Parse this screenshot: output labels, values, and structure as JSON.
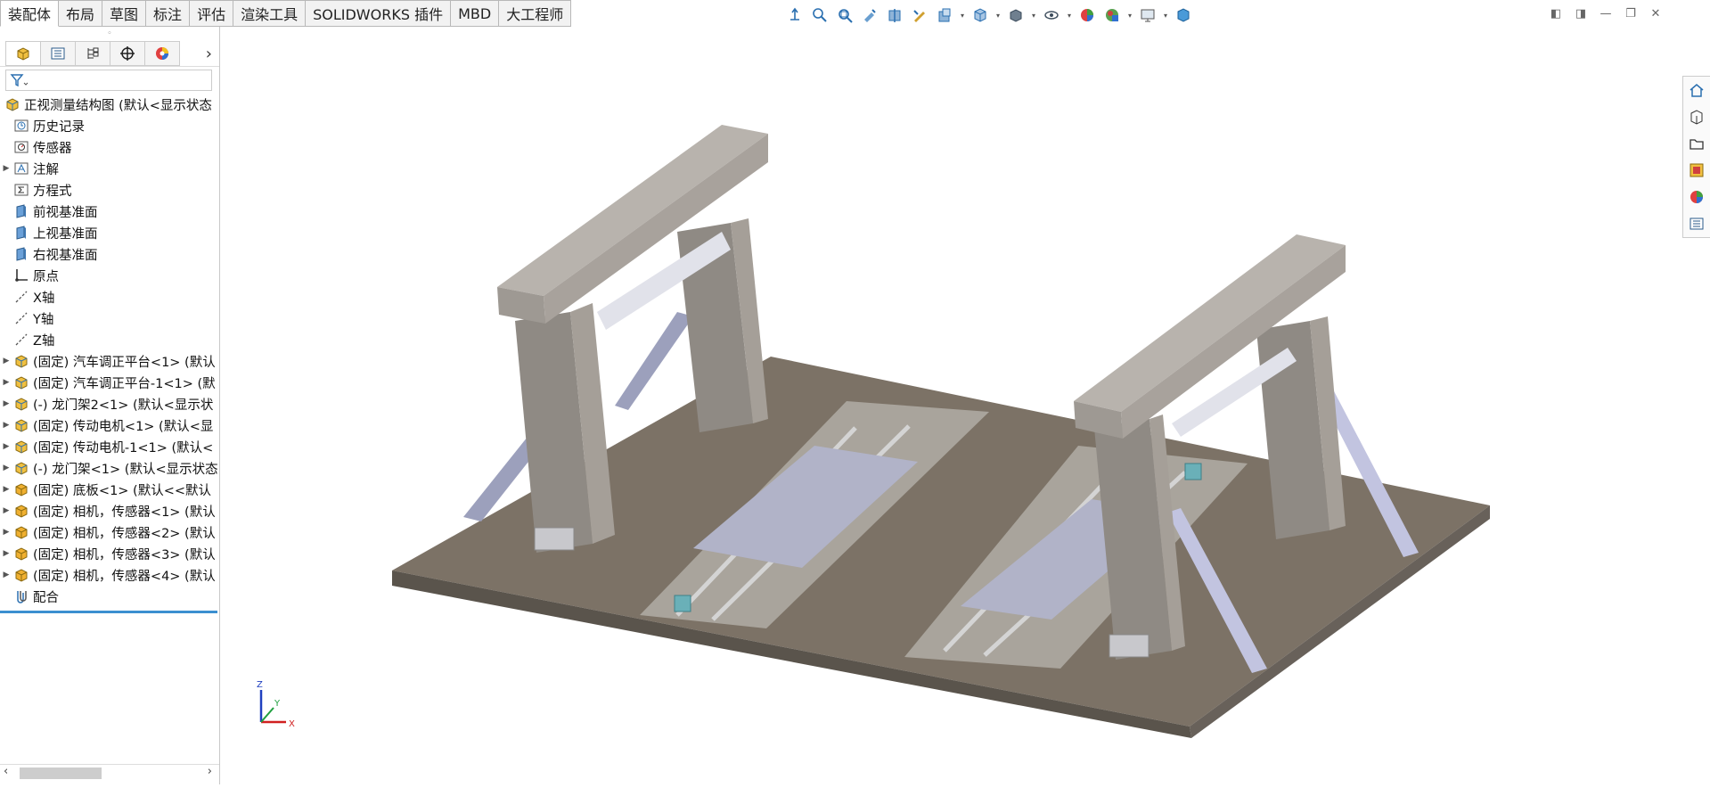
{
  "tabs": [
    {
      "label": "装配体",
      "active": true
    },
    {
      "label": "布局"
    },
    {
      "label": "草图"
    },
    {
      "label": "标注"
    },
    {
      "label": "评估"
    },
    {
      "label": "渲染工具"
    },
    {
      "label": "SOLIDWORKS 插件"
    },
    {
      "label": "MBD"
    },
    {
      "label": "大工程师"
    }
  ],
  "tree": {
    "root": "正视测量结构图 (默认<显示状态",
    "items": [
      {
        "label": "历史记录",
        "icon": "history-icon"
      },
      {
        "label": "传感器",
        "icon": "sensor-icon"
      },
      {
        "label": "注解",
        "icon": "annotation-icon",
        "expandable": true
      },
      {
        "label": "方程式",
        "icon": "equation-icon"
      },
      {
        "label": "前视基准面",
        "icon": "plane-icon"
      },
      {
        "label": "上视基准面",
        "icon": "plane-icon"
      },
      {
        "label": "右视基准面",
        "icon": "plane-icon"
      },
      {
        "label": "原点",
        "icon": "origin-icon"
      },
      {
        "label": "X轴",
        "icon": "axis-icon"
      },
      {
        "label": "Y轴",
        "icon": "axis-icon"
      },
      {
        "label": "Z轴",
        "icon": "axis-icon"
      },
      {
        "label": "(固定) 汽车调正平台<1> (默认",
        "icon": "assembly-icon",
        "expandable": true
      },
      {
        "label": "(固定) 汽车调正平台-1<1> (默",
        "icon": "assembly-icon",
        "expandable": true
      },
      {
        "label": "(-) 龙门架2<1> (默认<显示状",
        "icon": "assembly-icon",
        "expandable": true
      },
      {
        "label": "(固定) 传动电机<1> (默认<显",
        "icon": "assembly-icon",
        "expandable": true
      },
      {
        "label": "(固定) 传动电机-1<1> (默认<",
        "icon": "assembly-icon",
        "expandable": true
      },
      {
        "label": "(-) 龙门架<1> (默认<显示状态",
        "icon": "assembly-icon",
        "expandable": true
      },
      {
        "label": "(固定) 底板<1> (默认<<默认",
        "icon": "part-icon",
        "expandable": true
      },
      {
        "label": "(固定) 相机，传感器<1> (默认",
        "icon": "part-icon",
        "expandable": true
      },
      {
        "label": "(固定) 相机，传感器<2> (默认",
        "icon": "part-icon",
        "expandable": true
      },
      {
        "label": "(固定) 相机，传感器<3> (默认",
        "icon": "part-icon",
        "expandable": true
      },
      {
        "label": "(固定) 相机，传感器<4> (默认",
        "icon": "part-icon",
        "expandable": true
      },
      {
        "label": "配合",
        "icon": "mates-icon"
      }
    ]
  },
  "triad": {
    "z": "Z",
    "y": "Y",
    "x": "X"
  },
  "colors": {
    "accent": "#3c8fd0",
    "plate": "#7c7266",
    "steel": "#a09a92"
  }
}
